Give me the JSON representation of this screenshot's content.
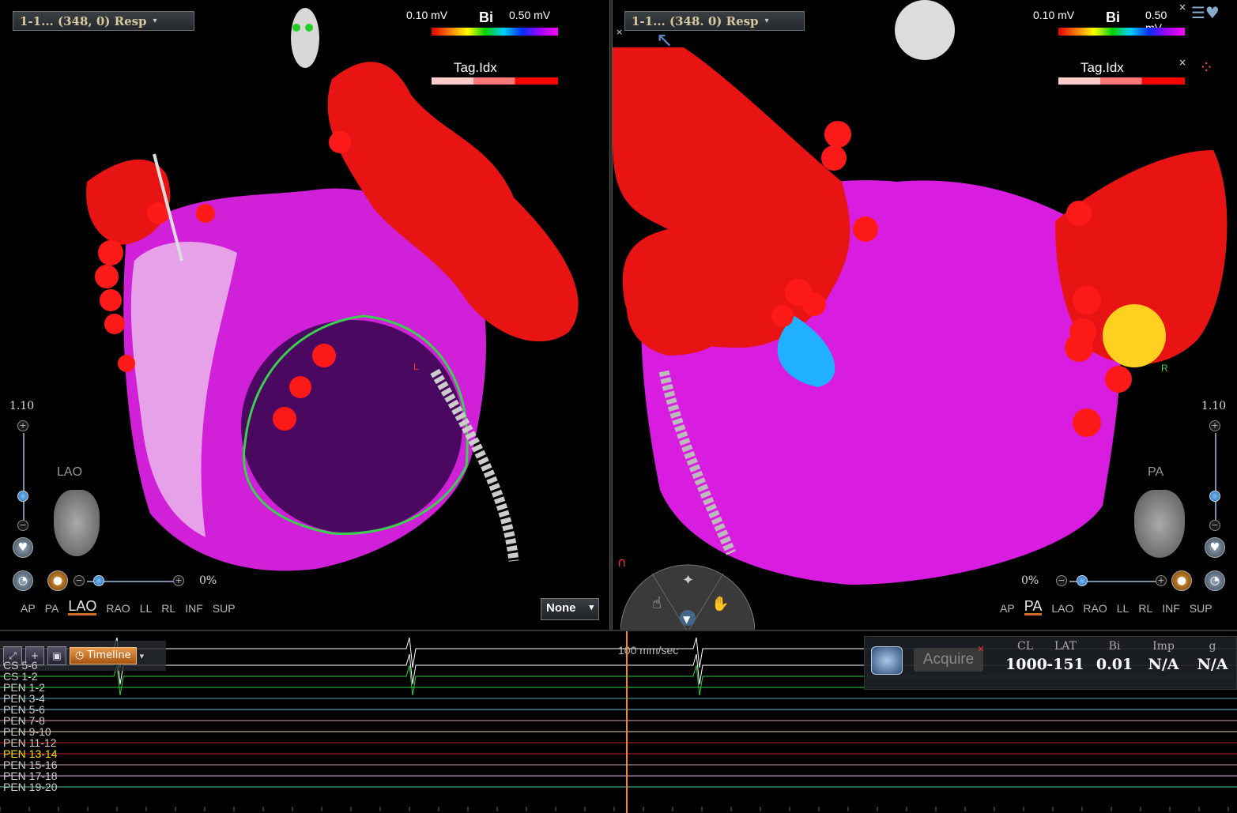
{
  "left_view": {
    "map_select": "1-1... (348, 0) Resp",
    "scale": {
      "min": "0.10 mV",
      "mode": "Bi",
      "max": "0.50 mV"
    },
    "tag_legend": "Tag.Idx",
    "zoom": "1.10",
    "orientation": "LAO",
    "transparency": "0%",
    "views": [
      "AP",
      "PA",
      "LAO",
      "RAO",
      "LL",
      "RL",
      "INF",
      "SUP"
    ],
    "active_view": "LAO",
    "none_select": "None",
    "marker": "L"
  },
  "right_view": {
    "map_select": "1-1... (348. 0) Resp",
    "scale": {
      "min": "0.10 mV",
      "mode": "Bi",
      "max": "0.50 mV"
    },
    "tag_legend": "Tag.Idx",
    "zoom": "1.10",
    "orientation": "PA",
    "transparency": "0%",
    "views": [
      "AP",
      "PA",
      "LAO",
      "RAO",
      "LL",
      "RL",
      "INF",
      "SUP"
    ],
    "active_view": "PA",
    "marker": "R"
  },
  "ecg": {
    "toolbar": {
      "timeline_label": "Timeline"
    },
    "time_scale": "100 mm/sec",
    "channels": [
      "CS 5-6",
      "CS 1-2",
      "PEN 1-2",
      "PEN 3-4",
      "PEN 5-6",
      "PEN 7-8",
      "PEN 9-10",
      "PEN 11-12",
      "PEN 13-14",
      "PEN 15-16",
      "PEN 17-18",
      "PEN 19-20"
    ],
    "channel_colors": [
      "#cccccc",
      "#cccccc",
      "#cccccc",
      "#cccccc",
      "#cccccc",
      "#cccccc",
      "#cccccc",
      "#cccccc",
      "#f0e000",
      "#cccccc",
      "#cccccc",
      "#cccccc"
    ],
    "line_colors": [
      "#ffffff",
      "#2ecc40",
      "#2ecc40",
      "#4aa",
      "#7bd",
      "#d9a",
      "#e8d8b0",
      "#cc2020",
      "#cc2020",
      "#c9a",
      "#e8a0e8",
      "#50c8a0"
    ],
    "acquire": {
      "button": "Acquire",
      "stats": [
        {
          "label": "CL",
          "value": "1000"
        },
        {
          "label": "LAT",
          "value": "-151"
        },
        {
          "label": "Bi",
          "value": "0.01"
        },
        {
          "label": "Imp",
          "value": "N/A"
        },
        {
          "label": "g",
          "value": "N/A"
        }
      ]
    }
  },
  "colors": {
    "tissue_healthy": "#d820d8",
    "tissue_scar": "#e01010",
    "catheter": "#cccccc"
  }
}
